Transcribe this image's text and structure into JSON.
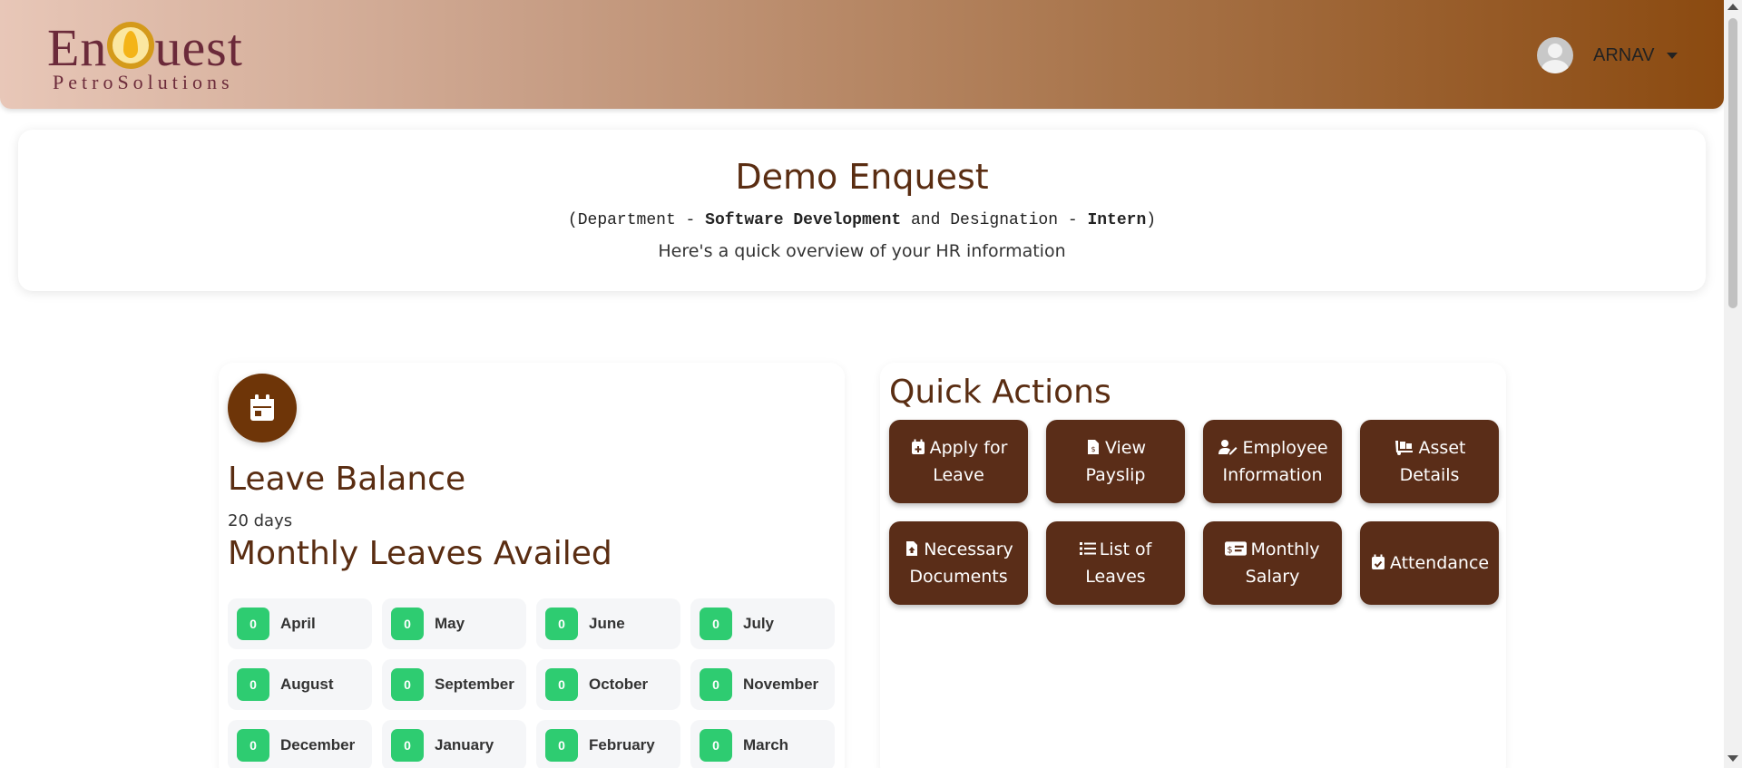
{
  "header": {
    "logo_main_left": "En",
    "logo_main_right": "uest",
    "logo_sub": "PetroSolutions",
    "user_name": "ARNAV"
  },
  "banner": {
    "title": "Demo Enquest",
    "dept_prefix": "(Department - ",
    "department": "Software Development",
    "dept_mid": " and Designation - ",
    "designation": "Intern",
    "dept_suffix": ")",
    "subtitle": "Here's a quick overview of your HR information"
  },
  "leave": {
    "title": "Leave Balance",
    "days": "20 days",
    "monthly_title": "Monthly Leaves Availed",
    "months": [
      {
        "name": "April",
        "count": "0"
      },
      {
        "name": "May",
        "count": "0"
      },
      {
        "name": "June",
        "count": "0"
      },
      {
        "name": "July",
        "count": "0"
      },
      {
        "name": "August",
        "count": "0"
      },
      {
        "name": "September",
        "count": "0"
      },
      {
        "name": "October",
        "count": "0"
      },
      {
        "name": "November",
        "count": "0"
      },
      {
        "name": "December",
        "count": "0"
      },
      {
        "name": "January",
        "count": "0"
      },
      {
        "name": "February",
        "count": "0"
      },
      {
        "name": "March",
        "count": "0"
      }
    ]
  },
  "quick_actions": {
    "title": "Quick Actions",
    "buttons": [
      {
        "label": "Apply for Leave",
        "icon": "calendar-plus-icon"
      },
      {
        "label": "View Payslip",
        "icon": "file-invoice-dollar-icon"
      },
      {
        "label": "Employee Information",
        "icon": "user-edit-icon"
      },
      {
        "label": "Asset Details",
        "icon": "dolly-icon"
      },
      {
        "label": "Necessary Documents",
        "icon": "file-upload-icon"
      },
      {
        "label": "List of Leaves",
        "icon": "list-icon"
      },
      {
        "label": "Monthly Salary",
        "icon": "money-check-icon"
      },
      {
        "label": "Attendance",
        "icon": "calendar-check-icon"
      }
    ]
  },
  "colors": {
    "brand_brown": "#5a2d12",
    "button_brown": "#5a2d18",
    "badge_green": "#2ecc71"
  }
}
